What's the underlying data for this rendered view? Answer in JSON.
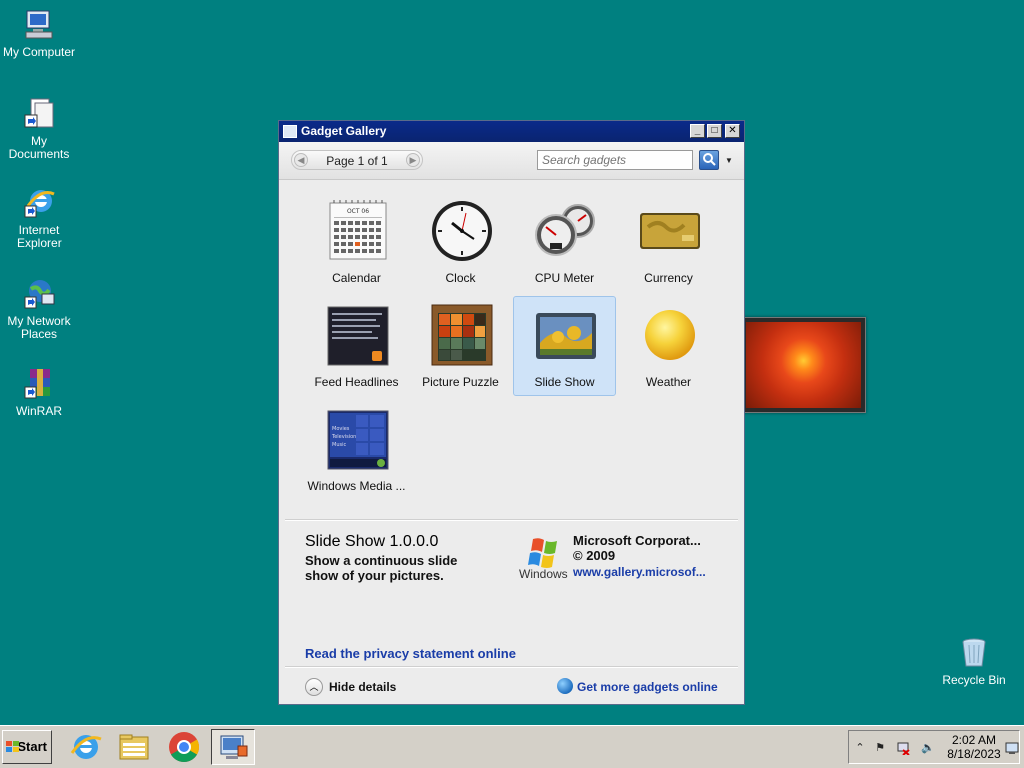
{
  "desktop": {
    "icons": [
      {
        "label": "My Computer"
      },
      {
        "label": "My Documents"
      },
      {
        "label": "Internet Explorer"
      },
      {
        "label": "My Network Places"
      },
      {
        "label": "WinRAR"
      },
      {
        "label": "Recycle Bin"
      }
    ]
  },
  "window": {
    "title": "Gadget Gallery",
    "pager": "Page 1 of 1",
    "search_placeholder": "Search gadgets",
    "gadgets": [
      {
        "name": "Calendar",
        "calendar_month": "OCT 06"
      },
      {
        "name": "Clock"
      },
      {
        "name": "CPU Meter"
      },
      {
        "name": "Currency"
      },
      {
        "name": "Feed Headlines"
      },
      {
        "name": "Picture Puzzle"
      },
      {
        "name": "Slide Show",
        "selected": true
      },
      {
        "name": "Weather"
      },
      {
        "name": "Windows Media ...",
        "menu": [
          "Movies",
          "Television",
          "Music"
        ]
      }
    ],
    "details": {
      "title": "Slide Show 1.0.0.0",
      "description": "Show a continuous slide show of your pictures.",
      "logo_text": "Windows",
      "publisher": "Microsoft Corporat...",
      "copyright": "© 2009",
      "link": "www.gallery.microsof...",
      "privacy": "Read the privacy statement online"
    },
    "footer": {
      "hide_details": "Hide details",
      "get_more": "Get more gadgets online"
    }
  },
  "taskbar": {
    "start_label": "Start",
    "time": "2:02 AM",
    "date": "8/18/2023"
  },
  "colors": {
    "desktop": "#008080",
    "titlebar": "#0a2470",
    "link": "#1a3da8",
    "selection": "#cfe3f8"
  }
}
